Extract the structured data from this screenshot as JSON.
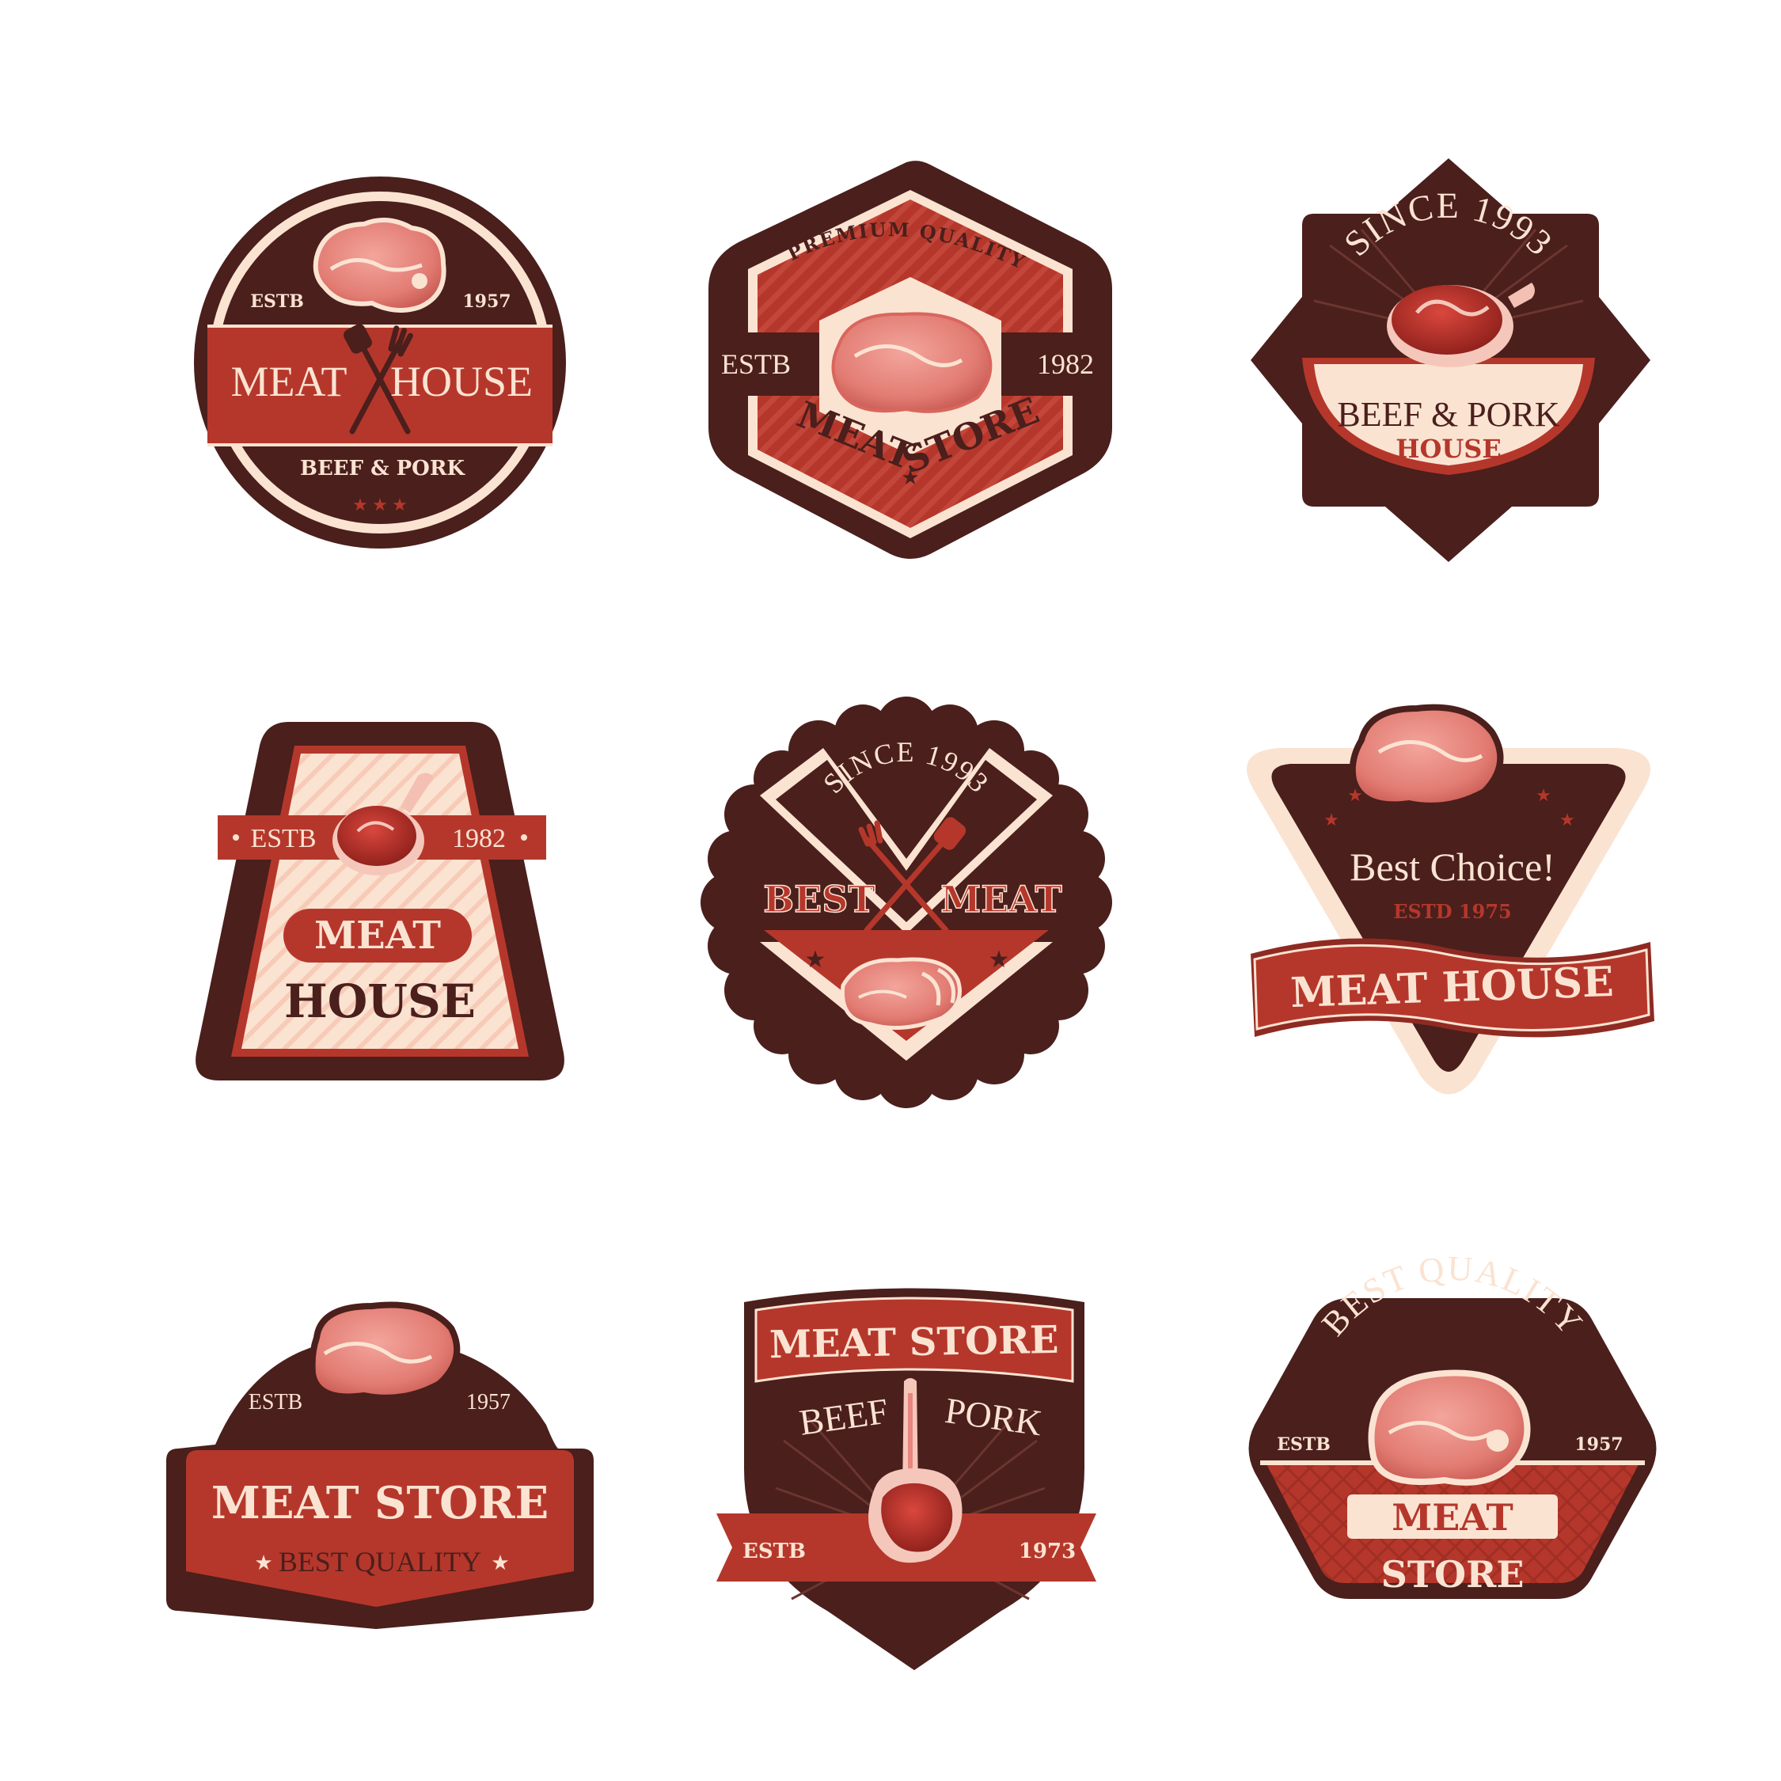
{
  "colors": {
    "dark_brown": "#4a1f1c",
    "red": "#b5372b",
    "deep_red": "#8f2a22",
    "cream": "#fbe3d2",
    "meat_pink": "#e9867e",
    "white": "#ffffff"
  },
  "badges": [
    {
      "id": "badge-1",
      "shape": "circle",
      "estb_left": "ESTB",
      "estb_right": "1957",
      "title_left": "MEAT",
      "title_right": "HOUSE",
      "subtitle": "BEEF & PORK",
      "icon": "fork-spatula-crossed-icon"
    },
    {
      "id": "badge-2",
      "shape": "hexagon",
      "arc_top": "PREMIUM QUALITY",
      "estb_left": "ESTB",
      "estb_right": "1982",
      "arc_bottom_left": "MEAT",
      "arc_bottom_right": "STORE",
      "icon": "steak-icon"
    },
    {
      "id": "badge-3",
      "shape": "starburst",
      "arc_top": "SINCE 1993",
      "title": "BEEF & PORK",
      "subtitle": "HOUSE",
      "icon": "ribeye-steak-icon"
    },
    {
      "id": "badge-4",
      "shape": "trapezoid",
      "estb_left": "ESTB",
      "estb_right": "1982",
      "title_top": "MEAT",
      "title_bottom": "HOUSE",
      "icon": "t-bone-steak-icon"
    },
    {
      "id": "badge-5",
      "shape": "scalloped-circle",
      "arc_top": "SINCE 1993",
      "title_left": "BEST",
      "title_right": "MEAT",
      "icon": "sliced-meat-icon"
    },
    {
      "id": "badge-6",
      "shape": "inverted-triangle",
      "title": "Best Choice!",
      "subtitle": "ESTD 1975",
      "ribbon": "MEAT HOUSE",
      "icon": "steak-icon"
    },
    {
      "id": "badge-7",
      "shape": "arched-label",
      "estb_left": "ESTB",
      "estb_right": "1957",
      "title": "MEAT STORE",
      "subtitle": "BEST QUALITY",
      "icon": "steak-icon"
    },
    {
      "id": "badge-8",
      "shape": "shield",
      "title": "MEAT STORE",
      "left_word": "BEEF",
      "right_word": "PORK",
      "estb_left": "ESTB",
      "estb_right": "1973",
      "icon": "lamb-rack-icon"
    },
    {
      "id": "badge-9",
      "shape": "rounded-hexagon",
      "arc_top": "BEST QUALITY",
      "estb_left": "ESTB",
      "estb_right": "1957",
      "title_top": "MEAT",
      "title_bottom": "STORE",
      "icon": "pork-chop-icon"
    }
  ]
}
